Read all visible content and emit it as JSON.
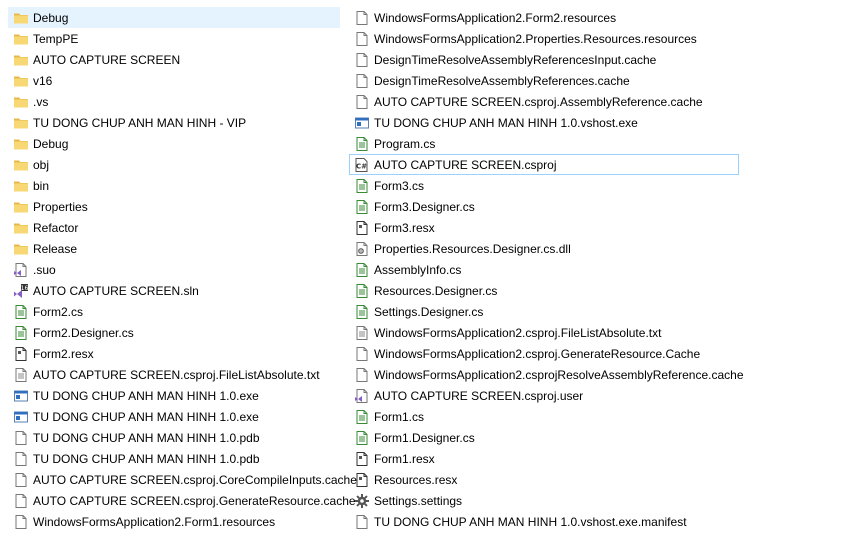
{
  "left_items": [
    {
      "name": "Debug",
      "icon": "folder-icon",
      "state": "hover"
    },
    {
      "name": "TempPE",
      "icon": "folder-icon"
    },
    {
      "name": "AUTO CAPTURE SCREEN",
      "icon": "folder-icon"
    },
    {
      "name": "v16",
      "icon": "folder-icon"
    },
    {
      "name": ".vs",
      "icon": "folder-icon"
    },
    {
      "name": "TU DONG CHUP ANH MAN HINH - VIP",
      "icon": "folder-icon"
    },
    {
      "name": "Debug",
      "icon": "folder-icon"
    },
    {
      "name": "obj",
      "icon": "folder-icon"
    },
    {
      "name": "bin",
      "icon": "folder-icon"
    },
    {
      "name": "Properties",
      "icon": "folder-icon"
    },
    {
      "name": "Refactor",
      "icon": "folder-icon"
    },
    {
      "name": "Release",
      "icon": "folder-icon"
    },
    {
      "name": ".suo",
      "icon": "suo-file-icon"
    },
    {
      "name": "AUTO CAPTURE SCREEN.sln",
      "icon": "visual-studio-solution-icon"
    },
    {
      "name": "Form2.cs",
      "icon": "csharp-file-icon"
    },
    {
      "name": "Form2.Designer.cs",
      "icon": "csharp-file-icon"
    },
    {
      "name": "Form2.resx",
      "icon": "resx-file-icon"
    },
    {
      "name": "AUTO CAPTURE SCREEN.csproj.FileListAbsolute.txt",
      "icon": "text-file-icon"
    },
    {
      "name": "TU DONG CHUP ANH MAN HINH 1.0.exe",
      "icon": "exe-file-icon"
    },
    {
      "name": "TU DONG CHUP ANH MAN HINH 1.0.exe",
      "icon": "exe-file-icon"
    },
    {
      "name": "TU DONG CHUP ANH MAN HINH 1.0.pdb",
      "icon": "blank-file-icon"
    },
    {
      "name": "TU DONG CHUP ANH MAN HINH 1.0.pdb",
      "icon": "blank-file-icon"
    },
    {
      "name": "AUTO CAPTURE SCREEN.csproj.CoreCompileInputs.cache",
      "icon": "blank-file-icon"
    },
    {
      "name": "AUTO CAPTURE SCREEN.csproj.GenerateResource.cache",
      "icon": "blank-file-icon"
    },
    {
      "name": "WindowsFormsApplication2.Form1.resources",
      "icon": "blank-file-icon"
    }
  ],
  "right_items": [
    {
      "name": "WindowsFormsApplication2.Form2.resources",
      "icon": "blank-file-icon"
    },
    {
      "name": "WindowsFormsApplication2.Properties.Resources.resources",
      "icon": "blank-file-icon"
    },
    {
      "name": "DesignTimeResolveAssemblyReferencesInput.cache",
      "icon": "blank-file-icon"
    },
    {
      "name": "DesignTimeResolveAssemblyReferences.cache",
      "icon": "blank-file-icon"
    },
    {
      "name": "AUTO CAPTURE SCREEN.csproj.AssemblyReference.cache",
      "icon": "blank-file-icon"
    },
    {
      "name": "TU DONG CHUP ANH MAN HINH 1.0.vshost.exe",
      "icon": "exe-file-icon"
    },
    {
      "name": "Program.cs",
      "icon": "csharp-file-icon"
    },
    {
      "name": "AUTO CAPTURE SCREEN.csproj",
      "icon": "csproj-file-icon",
      "state": "focus"
    },
    {
      "name": "Form3.cs",
      "icon": "csharp-file-icon"
    },
    {
      "name": "Form3.Designer.cs",
      "icon": "csharp-file-icon"
    },
    {
      "name": "Form3.resx",
      "icon": "resx-file-icon"
    },
    {
      "name": "Properties.Resources.Designer.cs.dll",
      "icon": "dll-file-icon"
    },
    {
      "name": "AssemblyInfo.cs",
      "icon": "csharp-file-icon"
    },
    {
      "name": "Resources.Designer.cs",
      "icon": "csharp-file-icon"
    },
    {
      "name": "Settings.Designer.cs",
      "icon": "csharp-file-icon"
    },
    {
      "name": "WindowsFormsApplication2.csproj.FileListAbsolute.txt",
      "icon": "text-file-icon"
    },
    {
      "name": "WindowsFormsApplication2.csproj.GenerateResource.Cache",
      "icon": "blank-file-icon"
    },
    {
      "name": "WindowsFormsApplication2.csprojResolveAssemblyReference.cache",
      "icon": "blank-file-icon"
    },
    {
      "name": "AUTO CAPTURE SCREEN.csproj.user",
      "icon": "visual-studio-user-icon"
    },
    {
      "name": "Form1.cs",
      "icon": "csharp-file-icon"
    },
    {
      "name": "Form1.Designer.cs",
      "icon": "csharp-file-icon"
    },
    {
      "name": "Form1.resx",
      "icon": "resx-file-icon"
    },
    {
      "name": "Resources.resx",
      "icon": "resx-file-icon"
    },
    {
      "name": "Settings.settings",
      "icon": "settings-gear-icon"
    },
    {
      "name": "TU DONG CHUP ANH MAN HINH 1.0.vshost.exe.manifest",
      "icon": "blank-file-icon"
    }
  ],
  "colors": {
    "hover_bg": "#e5f3ff",
    "focus_border": "#99d1ff",
    "folder_yellow": "#f8d775",
    "csharp_green": "#388a34"
  }
}
